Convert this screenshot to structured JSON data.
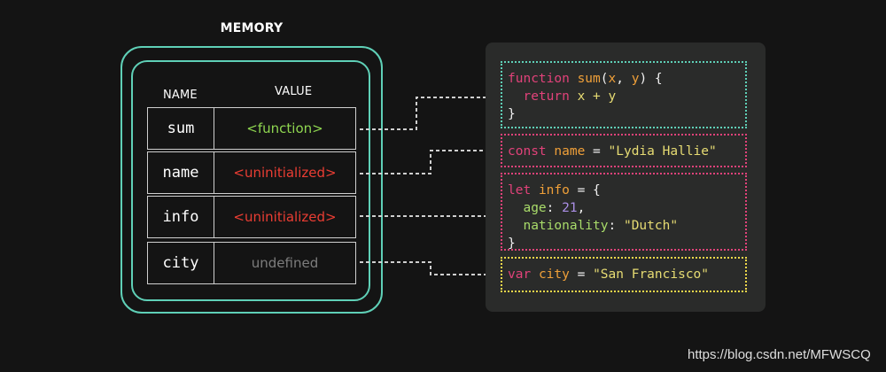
{
  "diagram": {
    "title": "MEMORY",
    "headers": {
      "name": "NAME",
      "value": "VALUE"
    },
    "rows": [
      {
        "name": "sum",
        "value": "<function>",
        "color": "#8fd650"
      },
      {
        "name": "name",
        "value": "<uninitialized>",
        "color": "#ea3d33"
      },
      {
        "name": "info",
        "value": "<uninitialized>",
        "color": "#ea3d33"
      },
      {
        "name": "city",
        "value": "undefined",
        "color": "#7d7d7d"
      }
    ],
    "colors": {
      "memory_border": "#5fd0b7",
      "block_sum": "#5fd0b7",
      "block_name": "#e2427a",
      "block_info": "#e2427a",
      "block_city": "#f0d84a",
      "connector": "#cfcfcf"
    },
    "code": {
      "sum": {
        "line1": {
          "kw": "function",
          "fn": "sum",
          "open": "(",
          "p1": "x",
          "comma": ", ",
          "p2": "y",
          "close": ") {"
        },
        "line2": {
          "kw": "return",
          "expr": "x + y"
        },
        "line3": "}"
      },
      "name": {
        "kw": "const",
        "id": "name",
        "eq": " = ",
        "str": "\"Lydia Hallie\""
      },
      "info": {
        "line1": {
          "kw": "let",
          "id": "info",
          "eq": " = {"
        },
        "age_key": "age",
        "age_colon": ": ",
        "age_val": "21",
        "age_comma": ",",
        "nat_key": "nationality",
        "nat_colon": ": ",
        "nat_val": "\"Dutch\"",
        "close": "}"
      },
      "city": {
        "kw": "var",
        "id": "city",
        "eq": " = ",
        "str": "\"San Francisco\""
      }
    }
  },
  "watermark": "https://blog.csdn.net/MFWSCQ"
}
